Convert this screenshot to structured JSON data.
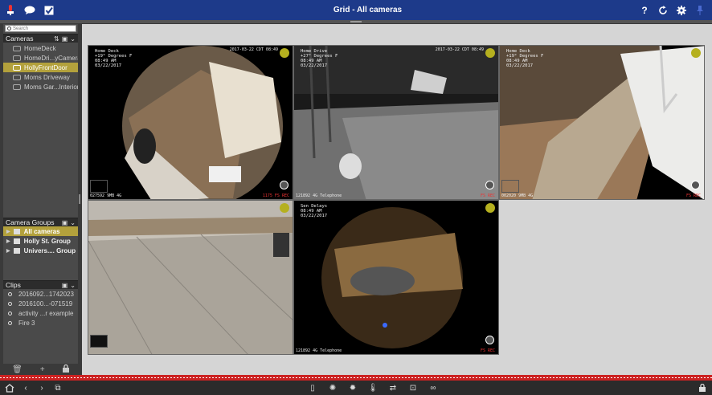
{
  "window": {
    "title": "Grid - All cameras"
  },
  "search": {
    "placeholder": "Search"
  },
  "cameras_panel": {
    "title": "Cameras",
    "items": [
      {
        "label": "HomeDeck",
        "selected": false
      },
      {
        "label": "HomeDri...yCamera",
        "selected": false
      },
      {
        "label": "HollyFrontDoor",
        "selected": true
      },
      {
        "label": "Moms Driveway",
        "selected": false
      },
      {
        "label": "Moms Gar...Interior",
        "selected": false
      }
    ]
  },
  "groups_panel": {
    "title": "Camera Groups",
    "items": [
      {
        "label": "All cameras",
        "selected": true
      },
      {
        "label": "Holly St. Group",
        "selected": false
      },
      {
        "label": "Univers.... Group",
        "selected": false
      }
    ]
  },
  "clips_panel": {
    "title": "Clips",
    "items": [
      {
        "label": "2016092...1742023"
      },
      {
        "label": "2016100...-071519"
      },
      {
        "label": "activity ...r example"
      },
      {
        "label": "Fire 3"
      }
    ]
  },
  "grid": {
    "cells": [
      {
        "overlay": "Home Deck\n+19° Degrees F\n08:49 AM\n03/22/2017",
        "timestamp": "2017-03-22 CDT 08:49",
        "bottom_left": "027592 9MB 4G",
        "bottom_right": "1175 FS REC"
      },
      {
        "overlay": "Home Drive\n+27° Degrees F\n08:49 AM\n03/22/2017",
        "timestamp": "2017-03-22 CDT 08:49",
        "bottom_left": "121892 4G Telephone",
        "bottom_right": "FS REC"
      },
      {
        "overlay": "Home Deck\n+19° Degrees F\n08:49 AM\n03/22/2017",
        "timestamp": "",
        "bottom_left": "002020 9MB 4G",
        "bottom_right": "FS REC"
      },
      {
        "overlay": "",
        "timestamp": "",
        "bottom_left": "",
        "bottom_right": ""
      },
      {
        "overlay": "Sen Delays\n08:49 AM\n03/22/2017",
        "timestamp": "",
        "bottom_left": "121892 4G Telephone",
        "bottom_right": "FS REC"
      }
    ]
  },
  "colors": {
    "titlebar": "#1d3a8a",
    "selection": "#b3a13c",
    "indicator": "#b5b01f",
    "recbar": "#cc2222"
  },
  "icons": {
    "titlebar_left": [
      "record-icon",
      "chat-icon",
      "checkbox-icon"
    ],
    "titlebar_right": [
      "help-icon",
      "refresh-icon",
      "settings-icon",
      "pin-icon"
    ],
    "bottom_left": [
      "home-icon",
      "back-icon",
      "forward-icon",
      "layout-icon"
    ],
    "bottom_center": [
      "phone-icon",
      "brightness-icon",
      "brightness-alt-icon",
      "temperature-icon",
      "swap-icon",
      "snapshot-icon",
      "link-icon"
    ],
    "bottom_right": [
      "lock-icon"
    ]
  }
}
